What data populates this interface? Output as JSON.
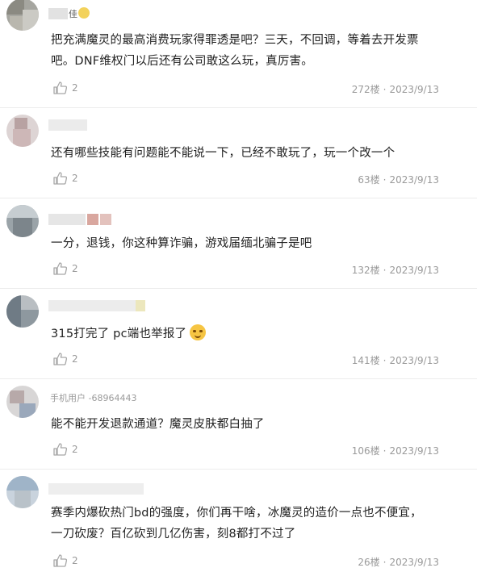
{
  "icons": {
    "like": "thumbs-up-icon",
    "emoji": "smirking-face-emoji"
  },
  "colors": {
    "meta_text": "#9a9a9a",
    "body_text": "#222222",
    "divider": "#ececec"
  },
  "comments": [
    {
      "username": "佳",
      "lines": [
        "把充满魔灵的最高消费玩家得罪透是吧？三天，不回调，等着去开发票",
        "吧。DNF维权门以后还有公司敢这么玩，真厉害。"
      ],
      "likes": "2",
      "floor": "272楼",
      "date": "2023/9/13"
    },
    {
      "username": "",
      "lines": [
        "还有哪些技能有问题能不能说一下，已经不敢玩了，玩一个改一个"
      ],
      "likes": "2",
      "floor": "63楼",
      "date": "2023/9/13"
    },
    {
      "username": "",
      "lines": [
        "一分，退钱，你这种算诈骗，游戏届缅北骗子是吧"
      ],
      "likes": "2",
      "floor": "132楼",
      "date": "2023/9/13"
    },
    {
      "username": "",
      "lines": [
        "315打完了 pc端也举报了"
      ],
      "likes": "2",
      "floor": "141楼",
      "date": "2023/9/13"
    },
    {
      "username": "手机用户 -68964443",
      "lines": [
        "能不能开发退款通道？魔灵皮肤都白抽了"
      ],
      "likes": "2",
      "floor": "106楼",
      "date": "2023/9/13"
    },
    {
      "username": "",
      "lines": [
        "赛季内爆砍热门bd的强度，你们再干啥，冰魔灵的造价一点也不便宜，",
        "一刀砍废？百亿砍到几亿伤害，刻8都打不过了"
      ],
      "likes": "2",
      "floor": "26楼",
      "date": "2023/9/13"
    }
  ]
}
